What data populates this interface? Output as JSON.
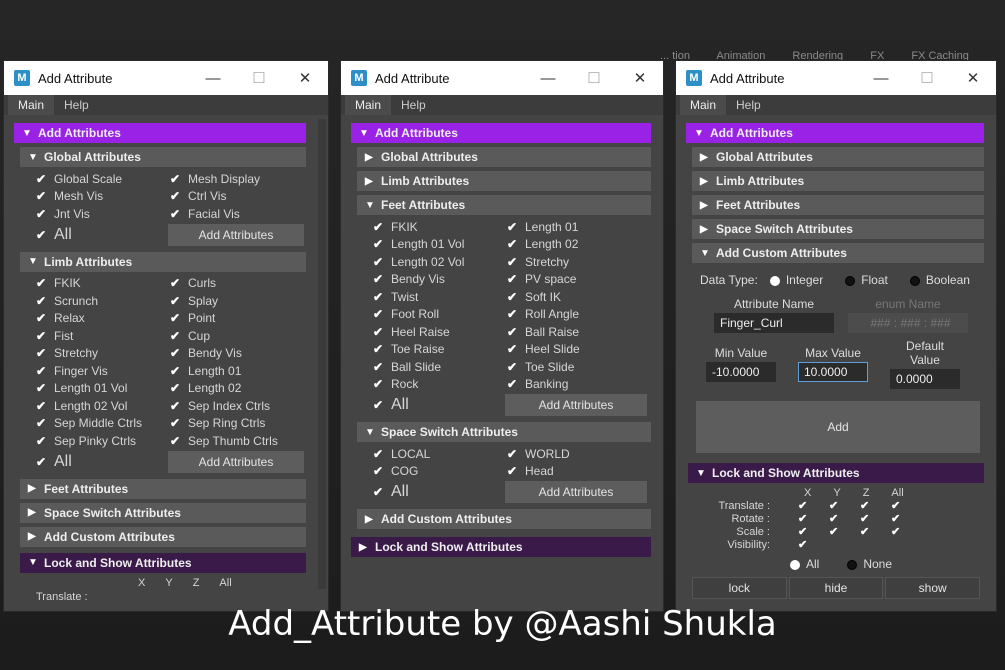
{
  "bg_menus": [
    "... tion",
    "Animation",
    "Rendering",
    "FX",
    "FX Caching"
  ],
  "caption": "Add_Attribute by @Aashi Shukla",
  "common": {
    "title": "Add Attribute",
    "logo": "M",
    "menu_main": "Main",
    "menu_help": "Help",
    "minimize": "—",
    "maximize": "☐",
    "close": "✕",
    "check": "✔",
    "collapsed": "▶",
    "expanded": "▼"
  },
  "w1": {
    "add_attributes": "Add Attributes",
    "global_title": "Global Attributes",
    "global": [
      "Global Scale",
      "Mesh Display",
      "Mesh Vis",
      "Ctrl Vis",
      "Jnt Vis",
      "Facial Vis"
    ],
    "global_all": "All",
    "global_btn": "Add Attributes",
    "limb_title": "Limb Attributes",
    "limb": [
      "FKIK",
      "Curls",
      "Scrunch",
      "Splay",
      "Relax",
      "Point",
      "Fist",
      "Cup",
      "Stretchy",
      "Bendy Vis",
      "Finger Vis",
      "Length 01",
      "Length 01 Vol",
      "Length 02",
      "Length 02 Vol",
      "Sep Index Ctrls",
      "Sep Middle Ctrls",
      "Sep Ring Ctrls",
      "Sep Pinky Ctrls",
      "Sep Thumb Ctrls"
    ],
    "limb_all": "All",
    "limb_btn": "Add Attributes",
    "feet_title": "Feet Attributes",
    "space_title": "Space Switch Attributes",
    "custom_title": "Add Custom Attributes",
    "lock_title": "Lock and Show Attributes",
    "axes": [
      "X",
      "Y",
      "Z",
      "All"
    ],
    "translate": "Translate :"
  },
  "w2": {
    "add_attributes": "Add Attributes",
    "global_title": "Global Attributes",
    "limb_title": "Limb Attributes",
    "feet_title": "Feet Attributes",
    "feet": [
      "FKIK",
      "Length 01",
      "Length 01 Vol",
      "Length 02",
      "Length 02 Vol",
      "Stretchy",
      "Bendy Vis",
      "PV space",
      "Twist",
      "Soft IK",
      "Foot Roll",
      "Roll Angle",
      "Heel Raise",
      "Ball Raise",
      "Toe Raise",
      "Heel Slide",
      "Ball Slide",
      "Toe Slide",
      "Rock",
      "Banking"
    ],
    "feet_all": "All",
    "feet_btn": "Add Attributes",
    "space_title": "Space Switch Attributes",
    "space": [
      "LOCAL",
      "WORLD",
      "COG",
      "Head"
    ],
    "space_all": "All",
    "space_btn": "Add Attributes",
    "custom_title": "Add Custom Attributes",
    "lock_title": "Lock and Show Attributes"
  },
  "w3": {
    "add_attributes": "Add Attributes",
    "global_title": "Global Attributes",
    "limb_title": "Limb Attributes",
    "feet_title": "Feet Attributes",
    "space_title": "Space Switch Attributes",
    "custom_title": "Add Custom Attributes",
    "data_type_label": "Data Type:",
    "dt_integer": "Integer",
    "dt_float": "Float",
    "dt_boolean": "Boolean",
    "attr_name_label": "Attribute Name",
    "attr_name_value": "Finger_Curl",
    "enum_name_label": "enum Name",
    "enum_name_placeholder": "### : ### : ###",
    "min_label": "Min Value",
    "min_value": "-10.0000",
    "max_label": "Max Value",
    "max_value": "10.0000",
    "default_label": "Default Value",
    "default_value": "0.0000",
    "add_btn": "Add",
    "lock_title": "Lock and Show Attributes",
    "axes": [
      "X",
      "Y",
      "Z",
      "All"
    ],
    "translate": "Translate :",
    "rotate": "Rotate :",
    "scale": "Scale :",
    "visibility": "Visibility:",
    "all_label": "All",
    "none_label": "None",
    "lock_btn": "lock",
    "hide_btn": "hide",
    "show_btn": "show"
  }
}
